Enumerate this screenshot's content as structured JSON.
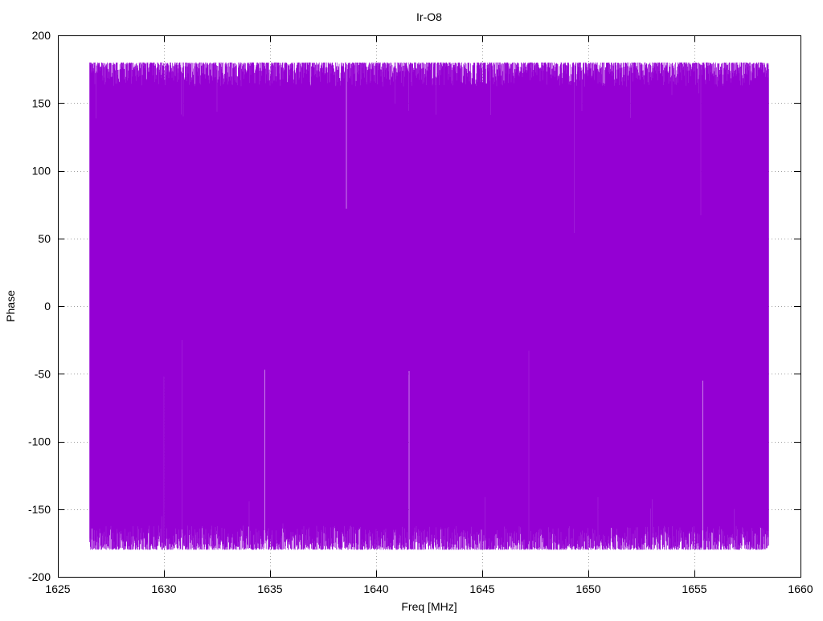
{
  "chart_data": {
    "type": "line",
    "title": "Ir-O8",
    "xlabel": "Freq [MHz]",
    "ylabel": "Phase",
    "xlim": [
      1625,
      1660
    ],
    "ylim": [
      -200,
      200
    ],
    "x_ticks": [
      "1625",
      "1630",
      "1635",
      "1640",
      "1645",
      "1650",
      "1655",
      "1660"
    ],
    "y_ticks": [
      "200",
      "150",
      "100",
      "50",
      "0",
      "-50",
      "-100",
      "-150",
      "-200"
    ],
    "grid": true,
    "legend": "none",
    "series": [
      {
        "x_start": 1626.5,
        "x_end": 1658.5,
        "y_min": -180,
        "y_max": 180,
        "color": "#9400d3",
        "notable_spikes": [
          {
            "x": 1630.0,
            "y": -52
          },
          {
            "x": 1630.85,
            "y": -25
          },
          {
            "x": 1634.75,
            "y": -47
          },
          {
            "x": 1641.55,
            "y": -48
          },
          {
            "x": 1647.2,
            "y": -33
          },
          {
            "x": 1655.4,
            "y": -55
          },
          {
            "x": 1649.35,
            "y": 54
          },
          {
            "x": 1638.6,
            "y": 72
          },
          {
            "x": 1655.3,
            "y": 67
          }
        ]
      }
    ]
  }
}
